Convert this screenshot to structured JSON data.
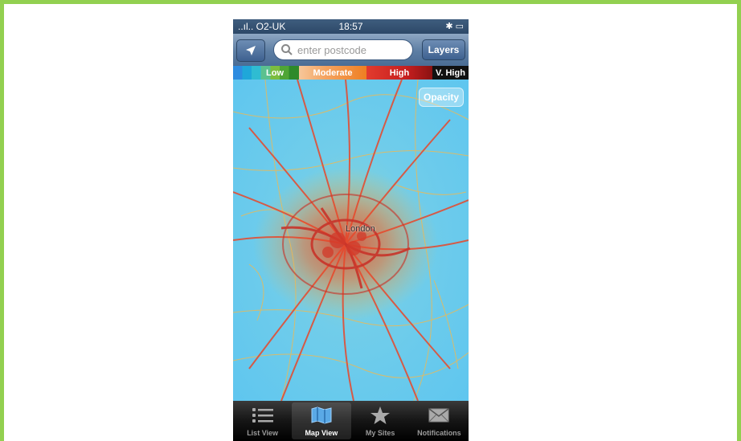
{
  "status_bar": {
    "carrier": "..ıl.. O2-UK",
    "time": "18:57",
    "right_icons": "✱ ▭"
  },
  "nav": {
    "search_placeholder": "enter postcode",
    "layers_label": "Layers"
  },
  "legend": [
    {
      "label": "Low"
    },
    {
      "label": "Moderate"
    },
    {
      "label": "High"
    },
    {
      "label": "V. High"
    }
  ],
  "map": {
    "opacity_label": "Opacity",
    "city_label": "London"
  },
  "tabs": [
    {
      "label": "List View",
      "icon": "list-icon"
    },
    {
      "label": "Map View",
      "icon": "map-icon",
      "selected": true
    },
    {
      "label": "My Sites",
      "icon": "star-icon"
    },
    {
      "label": "Notifications",
      "icon": "envelope-icon"
    }
  ],
  "colors": {
    "frame_border": "#92d050",
    "map_base": "#5fc6ef",
    "road_high": "#e8472a",
    "road_mod": "#f2a23a"
  }
}
